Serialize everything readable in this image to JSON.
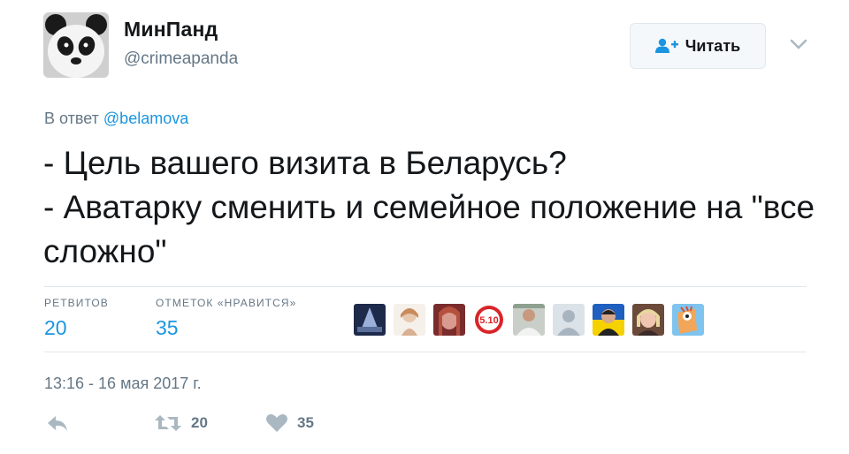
{
  "author": {
    "display_name": "МинПанд",
    "handle": "@crimeapanda",
    "avatar_icon": "panda-avatar"
  },
  "follow_button": {
    "label": "Читать",
    "icon": "add-user-icon"
  },
  "menu_icon": "chevron-down-icon",
  "reply": {
    "prefix": "В ответ",
    "mention": "@belamova"
  },
  "tweet": {
    "text": "- Цель вашего визита в Беларусь?\n- Аватарку сменить и семейное положение на \"все сложно\""
  },
  "stats": {
    "retweets_label": "РЕТВИТОВ",
    "retweets_value": "20",
    "likes_label": "ОТМЕТОК «НРАВИТСЯ»",
    "likes_value": "35"
  },
  "likers": [
    {
      "icon": "liker-avatar-1"
    },
    {
      "icon": "liker-avatar-2"
    },
    {
      "icon": "liker-avatar-3"
    },
    {
      "icon": "liker-avatar-4",
      "text": "5.10"
    },
    {
      "icon": "liker-avatar-5"
    },
    {
      "icon": "liker-avatar-6"
    },
    {
      "icon": "liker-avatar-7"
    },
    {
      "icon": "liker-avatar-8"
    },
    {
      "icon": "liker-avatar-9"
    }
  ],
  "timestamp": "13:16 - 16 мая 2017 г.",
  "actions": {
    "reply_icon": "reply-icon",
    "retweet_icon": "retweet-icon",
    "retweet_count": "20",
    "like_icon": "heart-icon",
    "like_count": "35"
  },
  "colors": {
    "link": "#1b95e0",
    "muted": "#657786",
    "text": "#14171a",
    "border": "#e1e8ed"
  }
}
